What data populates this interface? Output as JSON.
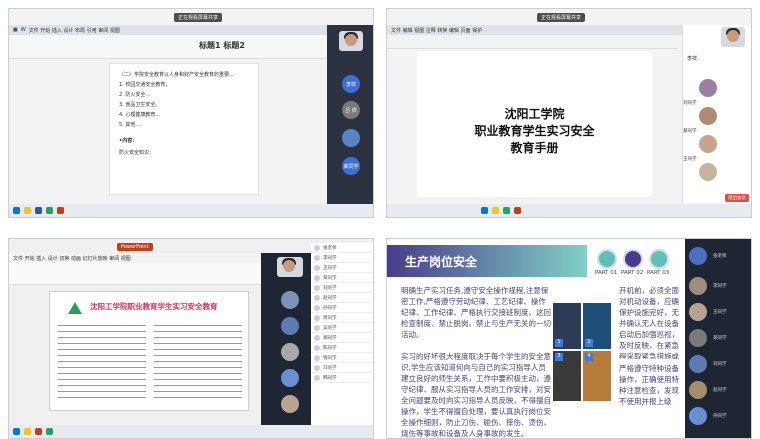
{
  "p1": {
    "share_badge": "正在观看屏幕共享",
    "title_line": "标题1  标题2",
    "user_label": "吕祥",
    "avatar_labels": [
      "李祥",
      "吕 祥",
      "某同学"
    ],
    "doc_lines": [
      "（二）学院安全教育以人身和财产安全教育的重要...",
      "1. 校园交通安全教育，",
      "2. 防火安全...",
      "3. 食品卫生安全。",
      "4. 心理健康教育...",
      "5. 其他..."
    ],
    "doc_heading": "•内容：",
    "doc_sub": "防火安全知识："
  },
  "p2": {
    "share_badge": "正在观看屏幕共享",
    "doc_title_1": "沈阳工学院",
    "doc_title_2": "职业教育学生实习安全",
    "doc_title_3": "教育手册",
    "button_end": "退出会议",
    "participants": [
      "李祥",
      "刘同学",
      "某同学",
      "王同学",
      "李同学",
      "张同学"
    ]
  },
  "p3": {
    "slide_title": "沈阳工学院职业教育学生实习安全教育",
    "participants": [
      "张老师",
      "李同学",
      "王同学",
      "某同学",
      "刘同学",
      "赵同学",
      "孙同学",
      "周同学",
      "吴同学",
      "郑同学",
      "陈同学",
      "钱同学",
      "冯同学",
      "韩同学"
    ]
  },
  "p4": {
    "slide_title": "生产岗位安全",
    "parts": [
      "PART 01",
      "PART 02",
      "PART 03"
    ],
    "para_1": "明确生产实习任务,遵守安全操作规程,注意保密工作,严格遵守劳动纪律、工艺纪律、操作纪律、工作纪律、严格执行交接班制度、这回检查制度、禁止脱岗、禁止与生产无关的一切活动。",
    "para_2": "实习的好坏很大程度取决于每个学生的安全意识,学生应该知道何向与自己的实习指导人员建立良好的师生关系，工作中要积极主动，遵守纪律、服从实习指导人员的工作安排，对安全问题要及时向实习指导人员反映，不得擅自操作，学生不得擅自处理，要认真执行岗位安全操作细则，防止刀伤、碰伤、摔伤、烫伤、烧伤等事故和设备及人身事故的发生。",
    "para_right_1": "开机前，必须全面对机动设备，应确保护设施完好，无并确认无人在设备启动后加强巡视，及时反映，在紧急程采取紧急措施或立",
    "para_right_2": "严格遵守特种设备操作，正确使用特种注意检查，发现不使用并报上级",
    "img_labels": [
      "1",
      "2",
      "3",
      "4"
    ],
    "participants": [
      "张老师",
      "李同学",
      "王同学",
      "某同学",
      "刘同学",
      "赵同学",
      "孙同学",
      "周同学",
      "吴同学"
    ]
  }
}
